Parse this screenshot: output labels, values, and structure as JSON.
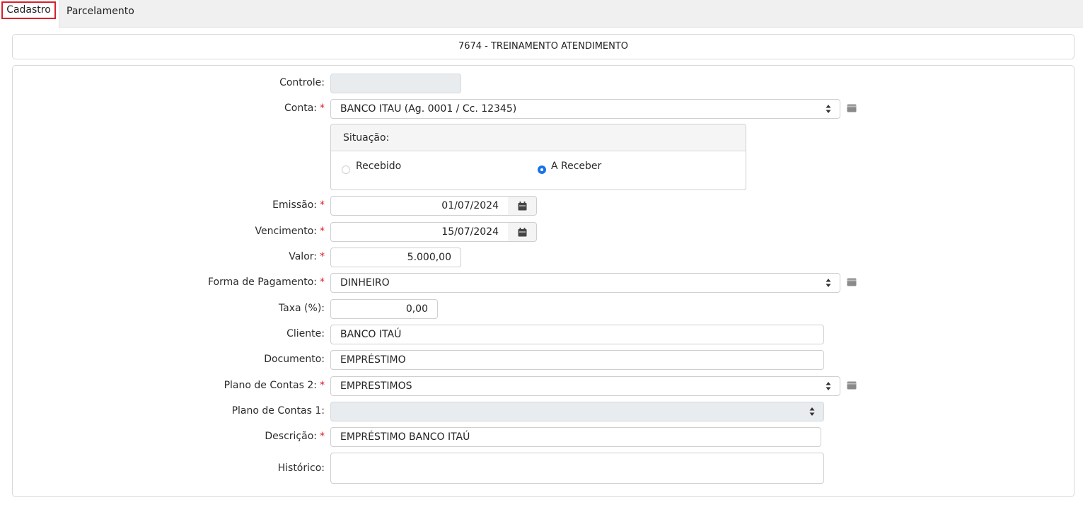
{
  "tabs": {
    "cadastro": "Cadastro",
    "parcelamento": "Parcelamento"
  },
  "header": {
    "title": "7674 - TREINAMENTO ATENDIMENTO"
  },
  "form": {
    "controle": {
      "label": "Controle:",
      "value": ""
    },
    "conta": {
      "label": "Conta:",
      "value": "BANCO ITAU (Ag. 0001 / Cc. 12345)"
    },
    "situacao": {
      "label": "Situação:",
      "options": [
        "Recebido",
        "A Receber"
      ],
      "selected": "A Receber"
    },
    "emissao": {
      "label": "Emissão:",
      "value": "01/07/2024"
    },
    "vencimento": {
      "label": "Vencimento:",
      "value": "15/07/2024"
    },
    "valor": {
      "label": "Valor:",
      "value": "5.000,00"
    },
    "forma_pagamento": {
      "label": "Forma de Pagamento:",
      "value": "DINHEIRO"
    },
    "taxa": {
      "label": "Taxa (%):",
      "value": "0,00"
    },
    "cliente": {
      "label": "Cliente:",
      "value": "BANCO ITAÚ"
    },
    "documento": {
      "label": "Documento:",
      "value": "EMPRÉSTIMO"
    },
    "plano_contas_2": {
      "label": "Plano de Contas 2:",
      "value": "EMPRESTIMOS"
    },
    "plano_contas_1": {
      "label": "Plano de Contas 1:",
      "value": ""
    },
    "descricao": {
      "label": "Descrição:",
      "value": "EMPRÉSTIMO BANCO ITAÚ"
    },
    "historico": {
      "label": "Histórico:",
      "value": ""
    }
  },
  "required_marker": "*",
  "colors": {
    "required": "#d8202a",
    "radio_checked": "#1a73e8",
    "tab_highlight": "#d8202a"
  },
  "icons": {
    "select": "select-arrows-icon",
    "side": "card-icon",
    "date": "calendar-icon"
  }
}
